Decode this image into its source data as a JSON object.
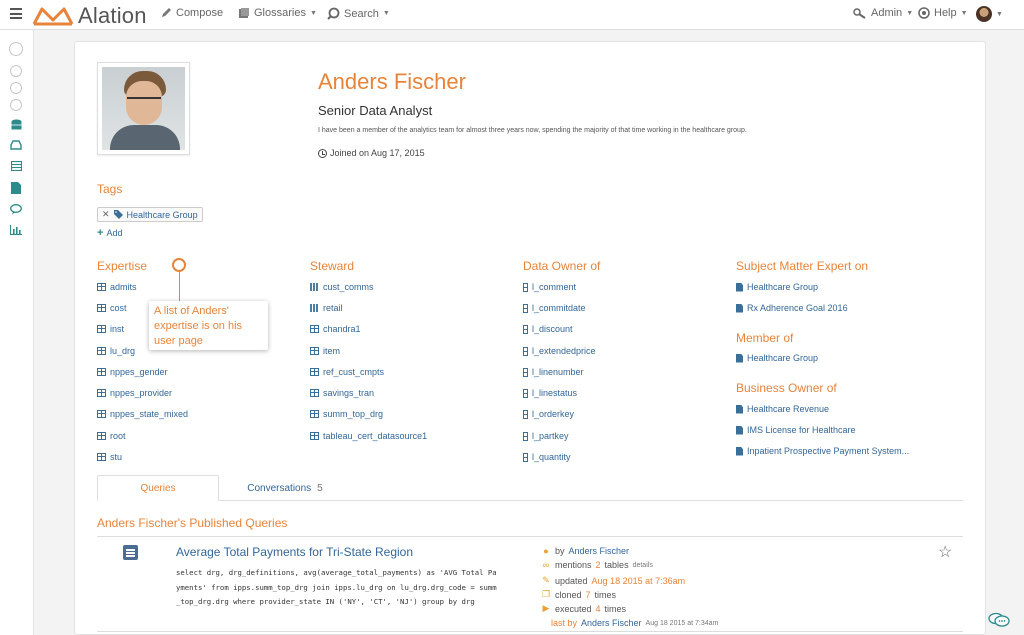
{
  "app": {
    "logo_text": "Alation"
  },
  "nav": {
    "compose": "Compose",
    "glossaries": "Glossaries",
    "search": "Search",
    "admin": "Admin",
    "help": "Help"
  },
  "profile": {
    "name": "Anders Fischer",
    "title": "Senior Data Analyst",
    "bio": "I have been a member of the analytics team for almost three years now, spending the majority of that time working in the healthcare group.",
    "joined": "Joined on Aug 17, 2015"
  },
  "tags": {
    "heading": "Tags",
    "items": [
      "Healthcare Group"
    ],
    "add_label": "Add"
  },
  "expertise": {
    "heading": "Expertise",
    "items": [
      "admits",
      "cost",
      "inst",
      "lu_drg",
      "nppes_gender",
      "nppes_provider",
      "nppes_state_mixed",
      "root",
      "stu"
    ]
  },
  "steward": {
    "heading": "Steward",
    "items": [
      "cust_comms",
      "retail",
      "chandra1",
      "item",
      "ref_cust_cmpts",
      "savings_tran",
      "summ_top_drg",
      "tableau_cert_datasource1"
    ]
  },
  "data_owner": {
    "heading": "Data Owner of",
    "items": [
      "l_comment",
      "l_commitdate",
      "l_discount",
      "l_extendedprice",
      "l_linenumber",
      "l_linestatus",
      "l_orderkey",
      "l_partkey",
      "l_quantity"
    ]
  },
  "sme": {
    "heading": "Subject Matter Expert on",
    "items": [
      "Healthcare Group",
      "Rx Adherence Goal 2016"
    ]
  },
  "member_of": {
    "heading": "Member of",
    "items": [
      "Healthcare Group"
    ]
  },
  "business_owner": {
    "heading": "Business Owner of",
    "items": [
      "Healthcare Revenue",
      "IMS License for Healthcare",
      "Inpatient Prospective Payment System..."
    ]
  },
  "callout": {
    "text": "A list of Anders' expertise is on his user page"
  },
  "tabs": {
    "queries": "Queries",
    "conversations": "Conversations",
    "conversations_count": "5"
  },
  "queries": {
    "heading": "Anders Fischer's Published Queries",
    "items": [
      {
        "title": "Average Total Payments for Tri-State Region",
        "sql_lines": [
          "select drg, drg_definitions, avg(average_total_payments) as 'AVG Total Pa",
          "yments' from ipps.summ_top_drg join ipps.lu_drg on lu_drg.drg_code = summ",
          "_top_drg.drg where provider_state IN ('NY', 'CT', 'NJ') group by drg"
        ],
        "by_label": "by",
        "author": "Anders Fischer",
        "mentions_label": "mentions",
        "mentions_count": "2",
        "mentions_unit": "tables",
        "details_label": "details",
        "updated_label": "updated",
        "updated_value": "Aug 18 2015 at 7:36am",
        "cloned_label": "cloned",
        "cloned_count": "7",
        "cloned_unit": "times",
        "executed_label": "executed",
        "executed_count": "4",
        "executed_unit": "times",
        "last_by_label": "last by",
        "last_by_user": "Anders Fischer",
        "last_by_time": "Aug 18 2015 at 7:34am"
      }
    ]
  },
  "colors": {
    "accent": "#e8843a",
    "link": "#336699",
    "teal": "#2e8b8b"
  }
}
